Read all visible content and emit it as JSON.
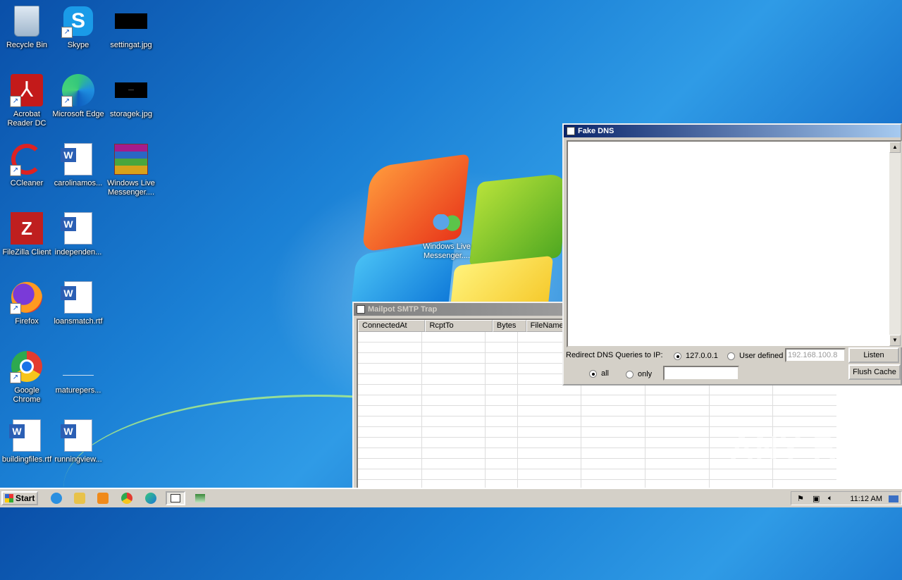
{
  "desktop": {
    "icons": [
      {
        "label": "Recycle Bin",
        "icon": "recycle-bin-icon"
      },
      {
        "label": "Skype",
        "icon": "skype-icon"
      },
      {
        "label": "settingat.jpg",
        "icon": "image-file-icon"
      },
      {
        "label": "Acrobat Reader DC",
        "icon": "acrobat-icon"
      },
      {
        "label": "Microsoft Edge",
        "icon": "edge-icon"
      },
      {
        "label": "storagek.jpg",
        "icon": "image-file-icon"
      },
      {
        "label": "CCleaner",
        "icon": "ccleaner-icon"
      },
      {
        "label": "carolinamos...",
        "icon": "word-doc-icon"
      },
      {
        "label": "Windows Live Messenger....",
        "icon": "winrar-icon"
      },
      {
        "label": "FileZilla Client",
        "icon": "filezilla-icon"
      },
      {
        "label": "independen...",
        "icon": "word-doc-icon"
      },
      {
        "label": "Firefox",
        "icon": "firefox-icon"
      },
      {
        "label": "loansmatch.rtf",
        "icon": "word-doc-icon"
      },
      {
        "label": "Google Chrome",
        "icon": "chrome-icon"
      },
      {
        "label": "maturepers...",
        "icon": "blank-file-icon"
      },
      {
        "label": "buildingfiles.rtf",
        "icon": "word-doc-icon"
      },
      {
        "label": "runningview...",
        "icon": "word-doc-icon"
      }
    ],
    "middle_icon_label": "Windows Live Messenger...."
  },
  "mailpot": {
    "title": "Mailpot SMTP Trap",
    "columns": [
      "ConnectedAt",
      "RcptTo",
      "Bytes",
      "FileName"
    ]
  },
  "fakedns": {
    "title": "Fake DNS",
    "redirect_label": "Redirect DNS Queries to IP:",
    "radio_local": "127.0.0.1",
    "radio_user": "User defined",
    "user_ip_value": "192.168.100.8",
    "listen_button": "Listen",
    "flush_button": "Flush Cache",
    "radio_all": "all",
    "radio_only": "only",
    "only_value": ""
  },
  "taskbar": {
    "start_label": "Start",
    "clock": "11:12 AM"
  },
  "watermark": "ANY RUN"
}
